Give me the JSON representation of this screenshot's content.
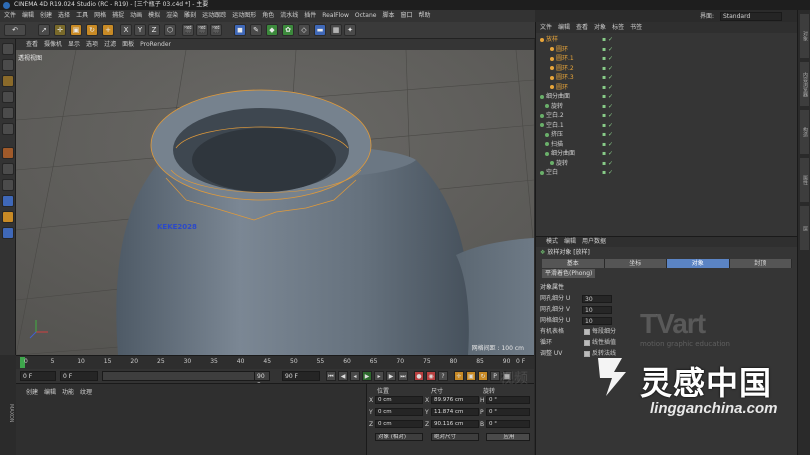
{
  "window": {
    "title": "CINEMA 4D R19.024 Studio (RC - R19) - [三个瓶子 03.c4d *] - 主要",
    "layout_label": "界面:",
    "layout_value": "Standard"
  },
  "menubar": [
    "文件",
    "编辑",
    "创建",
    "选择",
    "工具",
    "网格",
    "捕捉",
    "动画",
    "模拟",
    "渲染",
    "雕刻",
    "运动跟踪",
    "运动图形",
    "角色",
    "流水线",
    "插件",
    "RealFlow",
    "Octane",
    "脚本",
    "窗口",
    "帮助"
  ],
  "toolbar": {
    "axis_buttons": [
      "X",
      "Y",
      "Z"
    ]
  },
  "viewport": {
    "menu": [
      "查看",
      "摄像机",
      "显示",
      "选项",
      "过滤",
      "面板",
      "ProRender"
    ],
    "label": "透视视图",
    "grid_spacing": "网格间距 : 100 cm",
    "overlay_text": "KEKE2028"
  },
  "timeline": {
    "ticks": [
      "0",
      "5",
      "10",
      "15",
      "20",
      "25",
      "30",
      "35",
      "40",
      "45",
      "50",
      "55",
      "60",
      "65",
      "70",
      "75",
      "80",
      "85",
      "90"
    ],
    "current_frame": "0 F",
    "start_field": "0 F",
    "end_field": "90 F",
    "max_field": "90 F",
    "right_field": "0 F"
  },
  "materials": {
    "menu": [
      "创建",
      "编辑",
      "功能",
      "纹理"
    ]
  },
  "coordinates": {
    "headers": [
      "位置",
      "尺寸",
      "旋转"
    ],
    "rows": [
      {
        "axis": "X",
        "pos": "0 cm",
        "size_axis": "X",
        "size": "89.976 cm",
        "rot_axis": "H",
        "rot": "0 °"
      },
      {
        "axis": "Y",
        "pos": "0 cm",
        "size_axis": "Y",
        "size": "11.874 cm",
        "rot_axis": "P",
        "rot": "0 °"
      },
      {
        "axis": "Z",
        "pos": "0 cm",
        "size_axis": "Z",
        "size": "90.116 cm",
        "rot_axis": "B",
        "rot": "0 °"
      }
    ],
    "mode_select": "对象 (相对)",
    "size_select": "绝对尺寸",
    "apply_button": "应用"
  },
  "object_manager": {
    "menu": [
      "文件",
      "编辑",
      "查看",
      "对象",
      "标签",
      "书签"
    ],
    "rows": [
      {
        "label": "放样",
        "color": "#e8a53a",
        "indent": 0
      },
      {
        "label": "圆环",
        "color": "#e8a53a",
        "indent": 2
      },
      {
        "label": "圆环.1",
        "color": "#e8a53a",
        "indent": 2
      },
      {
        "label": "圆环.2",
        "color": "#e8a53a",
        "indent": 2
      },
      {
        "label": "圆环.3",
        "color": "#e8a53a",
        "indent": 2
      },
      {
        "label": "圆环",
        "color": "#e8a53a",
        "indent": 2
      },
      {
        "label": "细分曲面",
        "color": "#cfcfcf",
        "indent": 0
      },
      {
        "label": "旋转",
        "color": "#cfcfcf",
        "indent": 1
      },
      {
        "label": "空白.2",
        "color": "#cfcfcf",
        "indent": 0
      },
      {
        "label": "空白.1",
        "color": "#cfcfcf",
        "indent": 0
      },
      {
        "label": "挤压",
        "color": "#cfcfcf",
        "indent": 1
      },
      {
        "label": "扫描",
        "color": "#cfcfcf",
        "indent": 1
      },
      {
        "label": "细分曲面",
        "color": "#cfcfcf",
        "indent": 1
      },
      {
        "label": "旋转",
        "color": "#cfcfcf",
        "indent": 2
      },
      {
        "label": "空白",
        "color": "#cfcfcf",
        "indent": 0
      }
    ]
  },
  "attributes": {
    "menu": [
      "模式",
      "编辑",
      "用户数据"
    ],
    "object_title": "放样对象 [放样]",
    "tabs": [
      "基本",
      "坐标",
      "对象",
      "封顶"
    ],
    "active_tab": "对象",
    "phong_tab": "平滑着色(Phong)",
    "section_title": "对象属性",
    "fields": [
      {
        "label": "网孔细分 U",
        "value": "30"
      },
      {
        "label": "网孔细分 V",
        "value": "10"
      },
      {
        "label": "网格细分 U",
        "value": "10"
      }
    ],
    "checkboxes": [
      {
        "label": "有机表格",
        "right": "每段细分",
        "checked": true
      },
      {
        "label": "循环",
        "right": "线性插值",
        "checked": true
      },
      {
        "label": "调整 UV",
        "right": "反转法线",
        "checked": true
      }
    ]
  },
  "right_tabs": [
    "对象",
    "内容浏览器",
    "构造",
    "属性",
    "层"
  ],
  "watermarks": {
    "tvart": "TVart",
    "tvart_sub": "motion graphic education",
    "site_cn": "灵感中国",
    "site_url": "lingganchina.com",
    "faint": "视频"
  }
}
